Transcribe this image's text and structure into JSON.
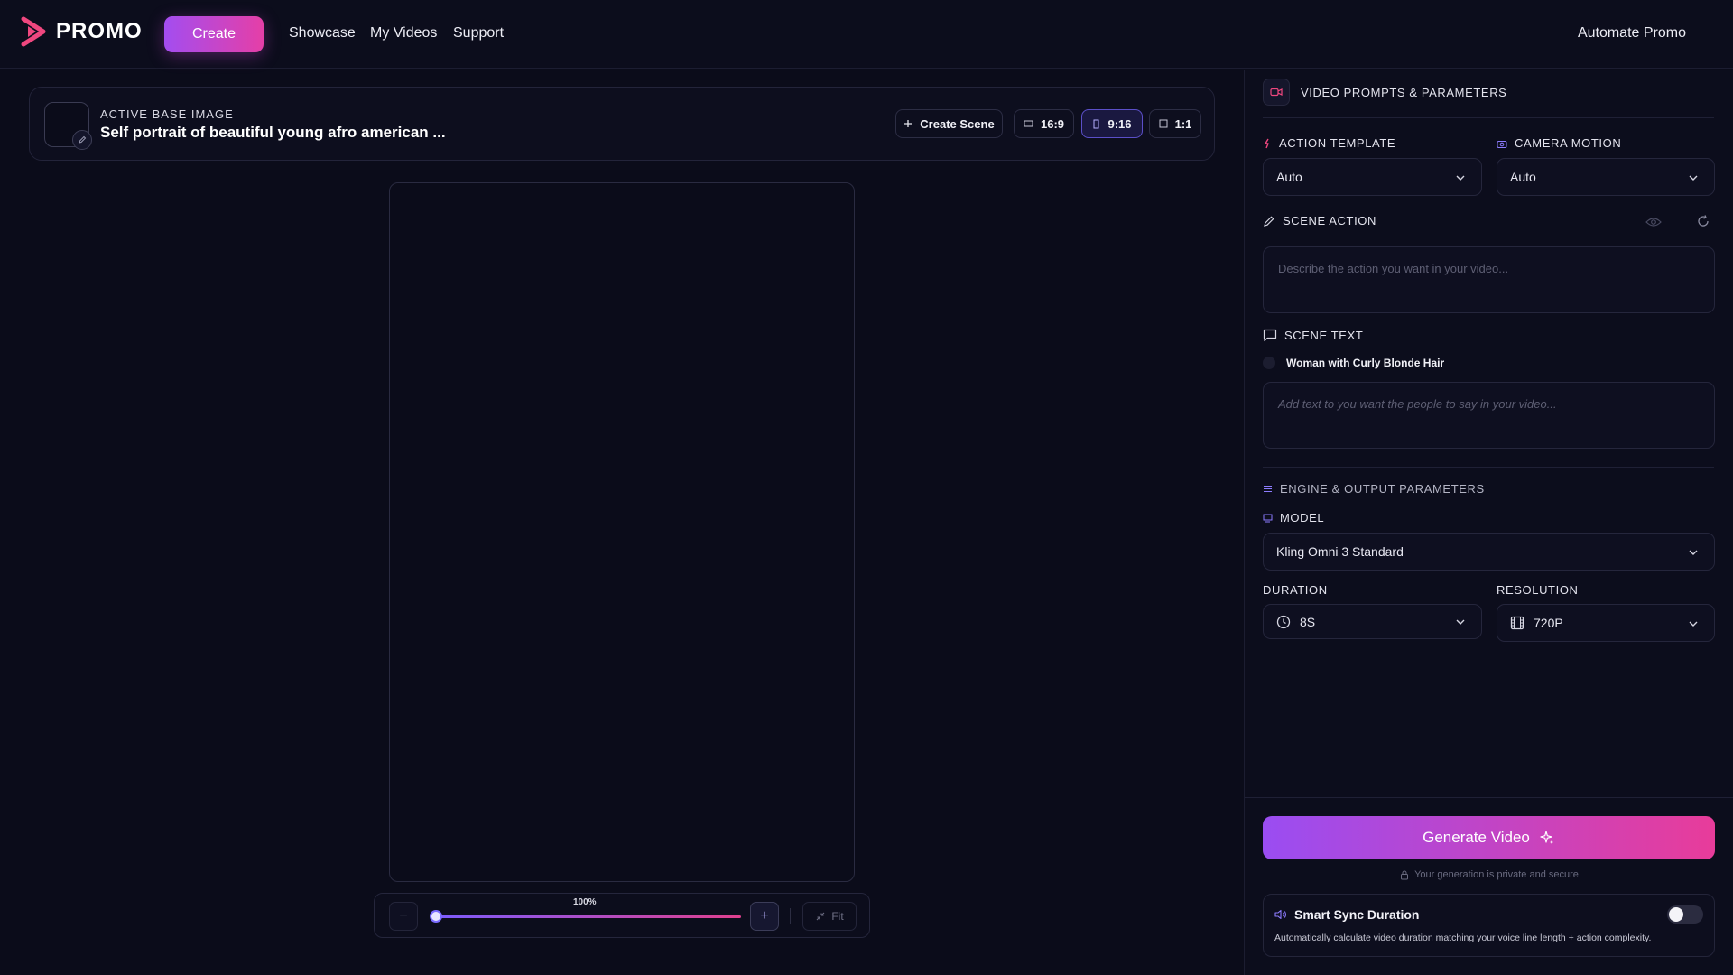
{
  "nav": {
    "brand": "PROMO",
    "create": "Create",
    "links": [
      "Showcase",
      "My Videos",
      "Support"
    ],
    "automate": "Automate Promo"
  },
  "active_image": {
    "label": "ACTIVE BASE IMAGE",
    "title": "Self portrait of beautiful young afro american ...",
    "create_scene": "Create Scene",
    "ratios": [
      "16:9",
      "9:16",
      "1:1"
    ],
    "selected_ratio": "9:16"
  },
  "zoom": {
    "percent_label": "100%",
    "value": 1.0,
    "minus": "−",
    "plus": "+",
    "fit": "Fit"
  },
  "panel": {
    "header": "VIDEO PROMPTS & PARAMETERS",
    "action_template": {
      "label": "ACTION TEMPLATE",
      "value": "Auto"
    },
    "camera_motion": {
      "label": "CAMERA MOTION",
      "value": "Auto"
    },
    "scene_action": {
      "label": "SCENE ACTION",
      "placeholder": "Describe the action you want in your video..."
    },
    "scene_text": {
      "label": "SCENE TEXT",
      "speaker": "Woman with Curly Blonde Hair",
      "placeholder": "Add text to you want the people to say in your video..."
    },
    "engine": {
      "label": "ENGINE & OUTPUT PARAMETERS",
      "model_label": "MODEL",
      "model_value": "Kling Omni 3 Standard",
      "duration_label": "DURATION",
      "duration_value": "8S",
      "resolution_label": "RESOLUTION",
      "resolution_value": "720P"
    },
    "generate": "Generate Video",
    "secure_note": "Your generation is private and secure",
    "smart_sync": {
      "title": "Smart Sync Duration",
      "description": "Automatically calculate video duration matching your voice line length + action complexity.",
      "enabled": false
    }
  },
  "colors": {
    "background": "#0b0c1a",
    "accent_purple": "#9a4df2",
    "accent_pink": "#e83c9a",
    "brand_icon": "#f0477f"
  }
}
